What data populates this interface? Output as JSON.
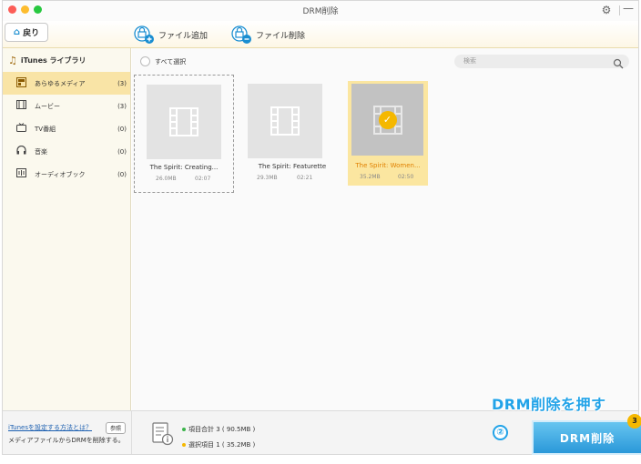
{
  "window": {
    "title": "DRM削除"
  },
  "toolbar": {
    "back_label": "戻り",
    "add_label": "ファイル追加",
    "remove_label": "ファイル削除"
  },
  "sidebar": {
    "header": "iTunes ライブラリ",
    "items": [
      {
        "label": "あらゆるメディア",
        "count": "(3)",
        "icon": "media-icon",
        "active": true
      },
      {
        "label": "ムービー",
        "count": "(3)",
        "icon": "film-icon",
        "active": false
      },
      {
        "label": "TV番組",
        "count": "(0)",
        "icon": "tv-icon",
        "active": false
      },
      {
        "label": "音楽",
        "count": "(0)",
        "icon": "headphones-icon",
        "active": false
      },
      {
        "label": "オーディオブック",
        "count": "(0)",
        "icon": "audiobook-icon",
        "active": false
      }
    ]
  },
  "main": {
    "select_all_label": "すべて選択",
    "search_placeholder": "検索",
    "files": [
      {
        "title": "The Spirit: Creating...",
        "size": "26.0MB",
        "duration": "02:07",
        "selected": false
      },
      {
        "title": "The Spirit: Featurette",
        "size": "29.3MB",
        "duration": "02:21",
        "selected": false
      },
      {
        "title": "The Spirit: Women...",
        "size": "35.2MB",
        "duration": "02:50",
        "selected": true
      }
    ]
  },
  "footer": {
    "help_link": "iTunesを設定する方法とは？",
    "ref_button": "参照",
    "help_note": "メディアファイルからDRMを削除する。",
    "total_items": "項目合計 3 ( 90.5MB )",
    "selected_items": "選択項目 1 ( 35.2MB )",
    "drm_button": "DRM削除",
    "drm_badge": "3"
  },
  "annotation": {
    "text": "DRM削除を押す",
    "step": "②"
  },
  "colors": {
    "accent_blue": "#22a3e8",
    "selected_yellow": "#fbe6a0",
    "badge_yellow": "#f5b800"
  }
}
